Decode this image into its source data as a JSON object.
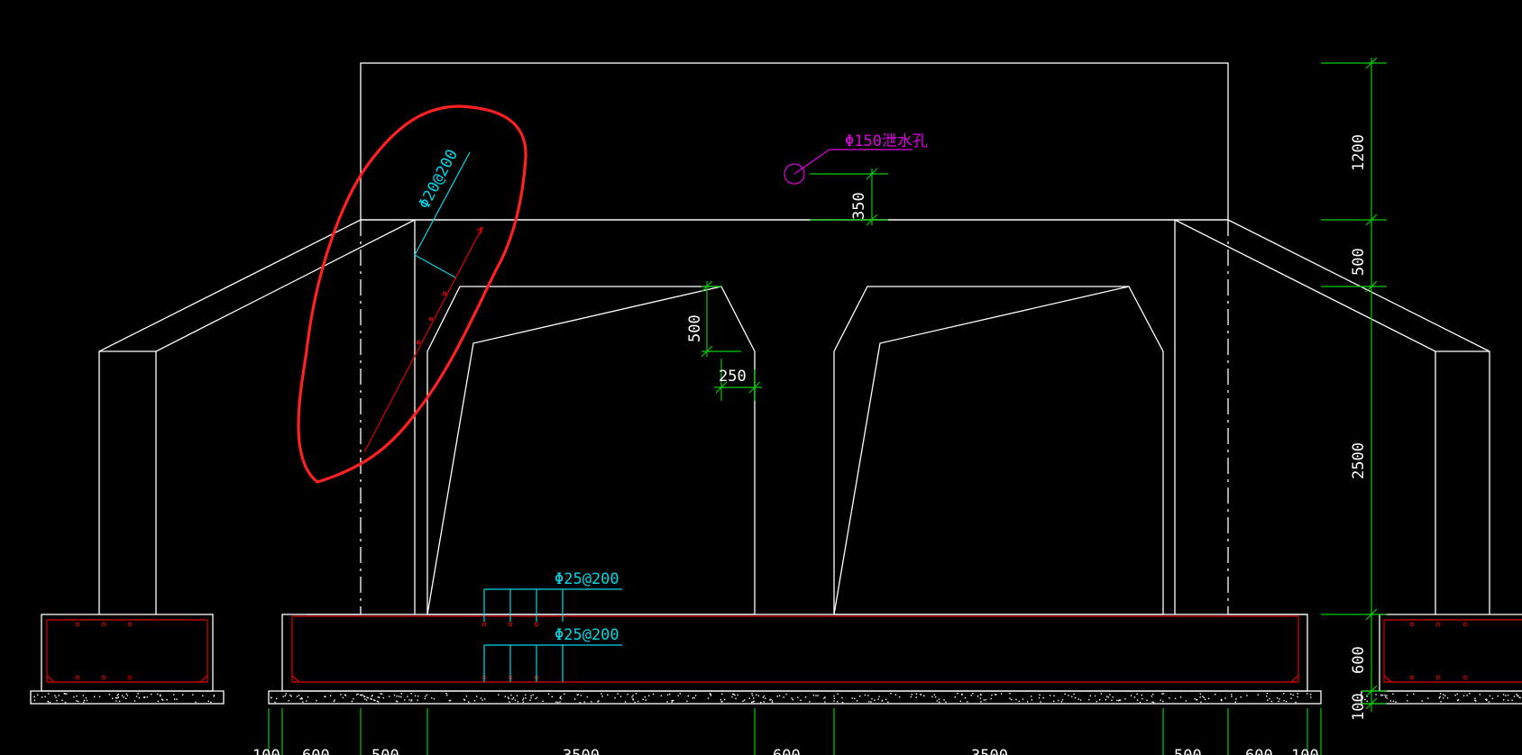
{
  "colors": {
    "background": "#000000",
    "outline": "#ffffff",
    "rebar": "#e00000",
    "rebar_label": "#00d8e8",
    "dimension": "#00cc00",
    "drain_hole": "#e000e0",
    "highlight": "#ff2020"
  },
  "labels": {
    "top_rebar": "Φ20@200",
    "bottom_rebar_upper": "Φ25@200",
    "bottom_rebar_lower": "Φ25@200",
    "drain_hole": "Φ150泄水孔"
  },
  "dimensions": {
    "vertical": [
      "1200",
      "500",
      "2500",
      "600",
      "100"
    ],
    "drain_offset": "350",
    "haunch_height": "500",
    "haunch_width": "250",
    "bottom": [
      "100",
      "600",
      "500",
      "3500",
      "600",
      "3500",
      "500",
      "600",
      "100"
    ]
  }
}
